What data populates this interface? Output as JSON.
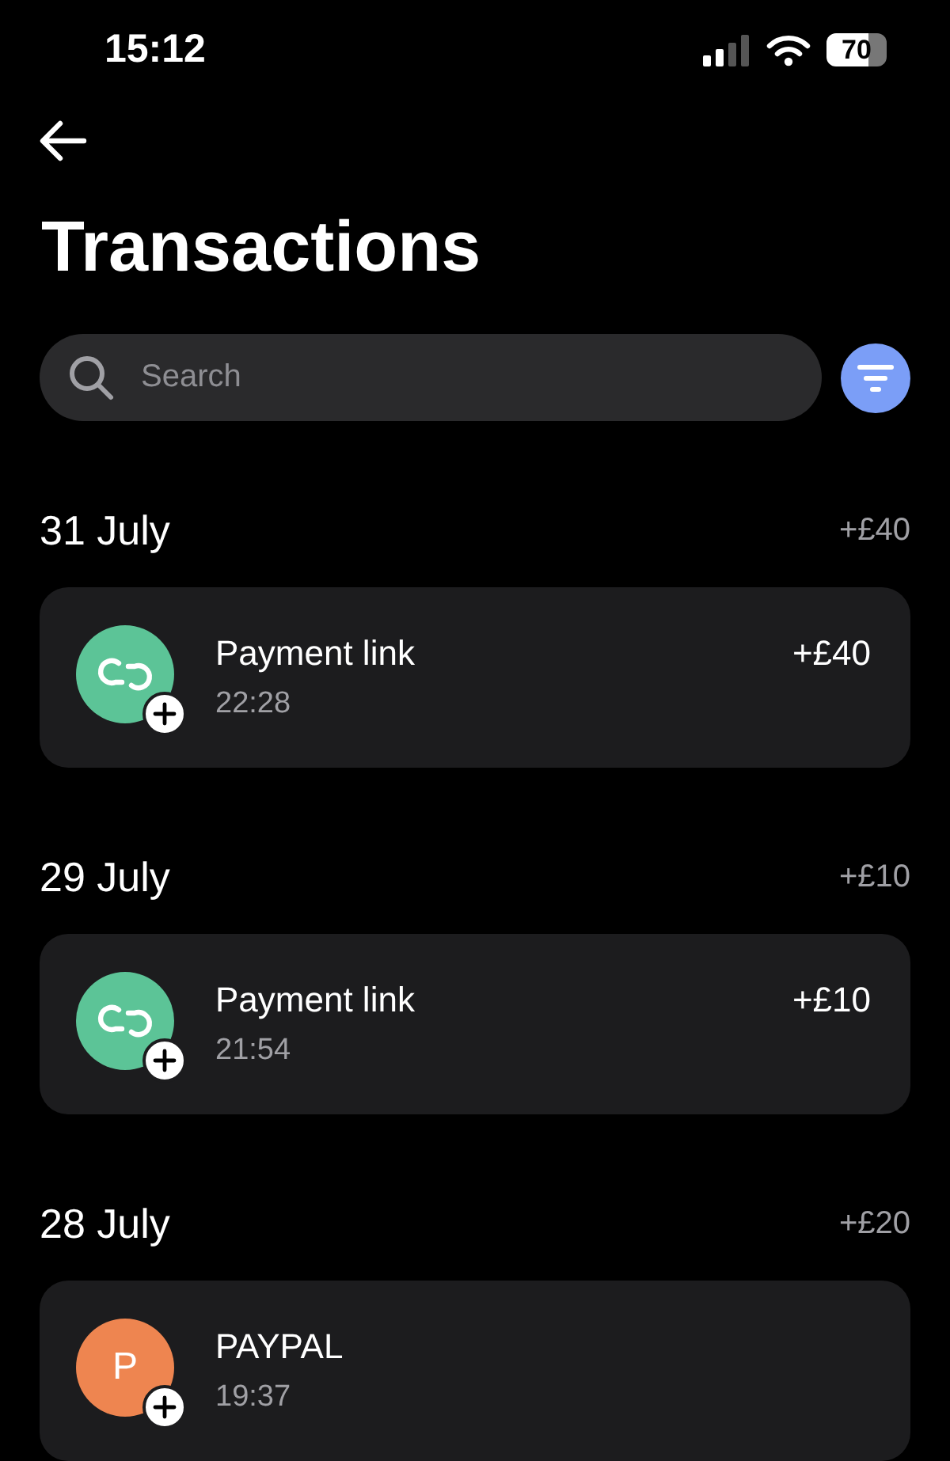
{
  "status_bar": {
    "time": "15:12",
    "battery": "70"
  },
  "title": "Transactions",
  "search": {
    "placeholder": "Search"
  },
  "sections": [
    {
      "date": "31 July",
      "total": "+£40",
      "items": [
        {
          "kind": "link",
          "name": "Payment link",
          "time": "22:28",
          "amount": "+£40",
          "color": "#5cc497"
        }
      ]
    },
    {
      "date": "29 July",
      "total": "+£10",
      "items": [
        {
          "kind": "link",
          "name": "Payment link",
          "time": "21:54",
          "amount": "+£10",
          "color": "#5cc497"
        }
      ]
    },
    {
      "date": "28 July",
      "total": "+£20",
      "items": [
        {
          "kind": "letter",
          "letter": "P",
          "name": "PAYPAL",
          "time": "19:37",
          "color": "#ee8550"
        }
      ]
    }
  ]
}
